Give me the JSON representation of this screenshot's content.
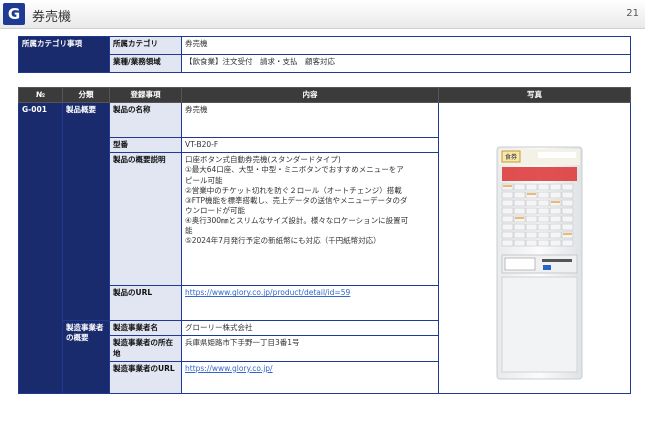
{
  "page": {
    "section_letter": "G",
    "title": "券売機",
    "page_number": "21"
  },
  "category": {
    "header": "所属カテゴリ事項",
    "rows": [
      {
        "label": "所属カテゴリ",
        "value": "券売機"
      },
      {
        "label": "業種/業務領域",
        "value": "【飲食業】注文受付　請求・支払　顧客対応"
      }
    ]
  },
  "table": {
    "headers": {
      "no": "№",
      "class": "分類",
      "item": "登録事項",
      "content": "内容",
      "photo": "写真"
    },
    "id": "G-001",
    "group1": "製品概要",
    "group2": "製造事業者の概要",
    "product_name_label": "製品の名称",
    "product_name": "券売機",
    "model_label": "型番",
    "model": "VT-B20-F",
    "desc_label": "製品の概要説明",
    "desc_lines": [
      "口座ボタン式自動券売機(スタンダードタイプ)",
      "①最大64口座、大型・中型・ミニボタンでおすすめメニューをア",
      "ピール可能",
      "②営業中のチケット切れを防ぐ２ロール（オートチェンジ）搭載",
      "③FTP機能を標準搭載し、売上データの送信やメニューデータのダ",
      "ウンロードが可能",
      "④奥行300㎜とスリムなサイズ設計。様々なロケーションに設置可",
      "能",
      "⑤2024年7月発行予定の新紙幣にも対応（千円紙幣対応）"
    ],
    "url_label": "製品のURL",
    "url": "https://www.glory.co.jp/product/detail/id=59",
    "maker_label": "製造事業者名",
    "maker": "グローリー株式会社",
    "maker_addr_label": "製造事業者の所在地",
    "maker_addr": "兵庫県姫路市下手野一丁目3番1号",
    "maker_url_label": "製造事業者のURL",
    "maker_url": "https://www.glory.co.jp/"
  },
  "photo": {
    "sign_text": "食券"
  }
}
